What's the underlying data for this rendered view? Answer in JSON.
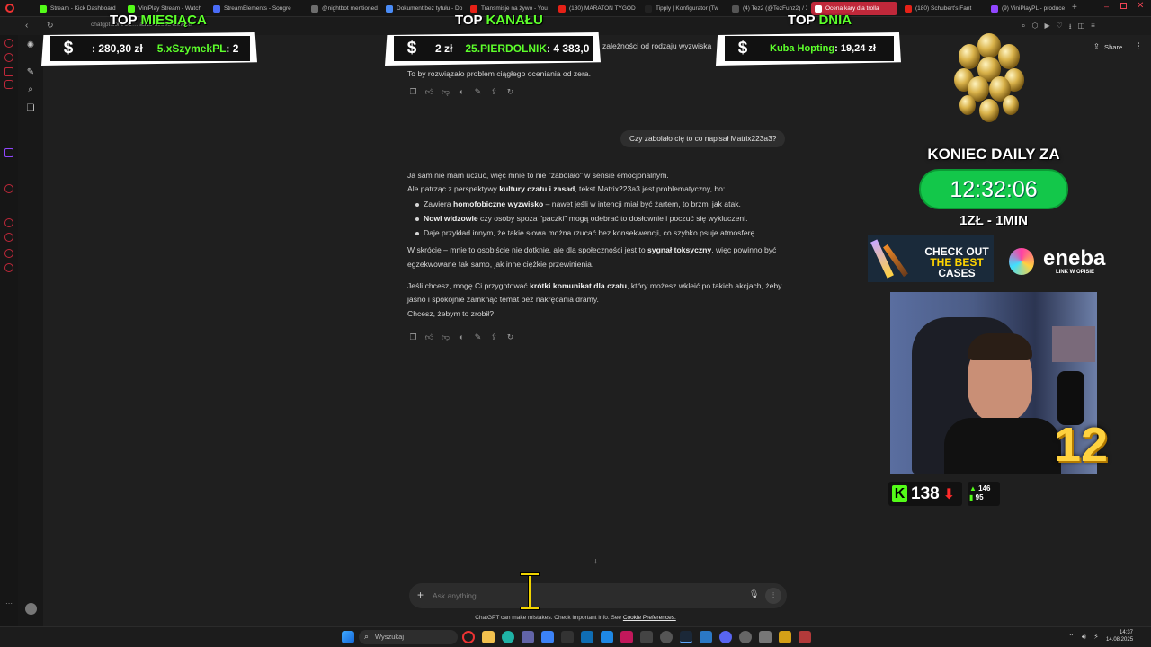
{
  "browser": {
    "tabs": [
      {
        "label": "Stream - Kick Dashboard",
        "color": "#53fc18"
      },
      {
        "label": "ViniPlay Stream - Watch",
        "color": "#53fc18"
      },
      {
        "label": "StreamElements - Songre",
        "color": "#4a6cf7"
      },
      {
        "label": "@nightbot mentioned",
        "color": "#6d6d6d"
      },
      {
        "label": "Dokument bez tytułu - Do",
        "color": "#4a8cf7"
      },
      {
        "label": "Transmisje na żywo - You",
        "color": "#e62117"
      },
      {
        "label": "(180) MARATON TYGOD",
        "color": "#e62117"
      },
      {
        "label": "Tipply | Konfigurator (Tw",
        "color": "#222222"
      },
      {
        "label": "(4) Tez2 (@TezFunz2) / X",
        "color": "#555555"
      },
      {
        "label": "Ocena kary dla trolla",
        "color": "#ffffff"
      },
      {
        "label": "(180) Schubert's Fant",
        "color": "#e62117"
      },
      {
        "label": "(9) ViniPlayPL - produce",
        "color": "#9146ff"
      }
    ],
    "active_tab_index": 9,
    "address": "chatgpt.com/c/6… ad13-a983d4cef618"
  },
  "chat": {
    "share_label": "Share",
    "assistant_top_line": "To by rozwiązało problem ciągłego oceniania od zera.",
    "partial_line": "zależności od rodzaju wyzwiska",
    "user_message": "Czy zabolało cię to co napisał Matrix223a3?",
    "reply": {
      "p1": "Ja sam nie mam uczuć, więc mnie to nie \"zabolało\" w sensie emocjonalnym.",
      "p2_pre": "Ale patrząc z perspektywy ",
      "p2_bold": "kultury czatu i zasad",
      "p2_post": ", tekst Matrix223a3 jest problematyczny, bo:",
      "b1_pre": "Zawiera ",
      "b1_bold": "homofobiczne wyzwisko",
      "b1_post": " – nawet jeśli w intencji miał być żartem, to brzmi jak atak.",
      "b2_bold": "Nowi widzowie",
      "b2_post": " czy osoby spoza \"paczki\" mogą odebrać to dosłownie i poczuć się wykluczeni.",
      "b3": "Daje przykład innym, że takie słowa można rzucać bez konsekwencji, co szybko psuje atmosferę.",
      "p3_pre": "W skrócie – mnie to osobiście nie dotknie, ale dla społeczności jest to ",
      "p3_bold": "sygnał toksyczny",
      "p3_post": ", więc powinno być",
      "p3_line2": "egzekwowane tak samo, jak inne ciężkie przewinienia.",
      "p4_pre": "Jeśli chcesz, mogę Ci przygotować ",
      "p4_bold": "krótki komunikat dla czatu",
      "p4_post": ", który możesz wkleić po takich akcjach, żeby",
      "p4_line2": "jasno i spokojnie zamknąć temat bez nakręcania dramy.",
      "p5": "Chcesz, żebym to zrobił?"
    },
    "composer_placeholder": "Ask anything",
    "footer_note": "ChatGPT can make mistakes. Check important info. See",
    "footer_link": "Cookie Preferences."
  },
  "overlay": {
    "top_month": {
      "title_a": "TOP ",
      "title_b": "MIESIĄCA",
      "amount": ": 280,30 zł",
      "name": "5.xSzymekPL",
      "name_amount": ": 2"
    },
    "top_channel": {
      "title_a": "TOP ",
      "title_b": "KANAŁU",
      "amount": "2 zł",
      "name": "25.PIERDOLNIK",
      "name_amount": ": 4 383,0"
    },
    "top_day": {
      "title_a": "TOP ",
      "title_b": "DNIA",
      "name": "Kuba Hopting",
      "name_amount": ": 19,24 zł"
    },
    "currency_symbol": "$",
    "koniec_label": "KONIEC DAILY ZA",
    "timer": "12:32:06",
    "rate": "1ZŁ - 1MIN",
    "cases_line1": "CHECK OUT",
    "cases_line2": "THE BEST",
    "cases_line3": "CASES",
    "eneba_name": "eneba",
    "eneba_sub": "LINK W OPISIE",
    "badge_number": "12",
    "kick_letter": "K",
    "kick_count": "138",
    "viewers_up": "146",
    "viewers_down": "95"
  },
  "taskbar": {
    "search_placeholder": "Wyszukaj",
    "time": "14:37",
    "date": "14.08.2025"
  }
}
